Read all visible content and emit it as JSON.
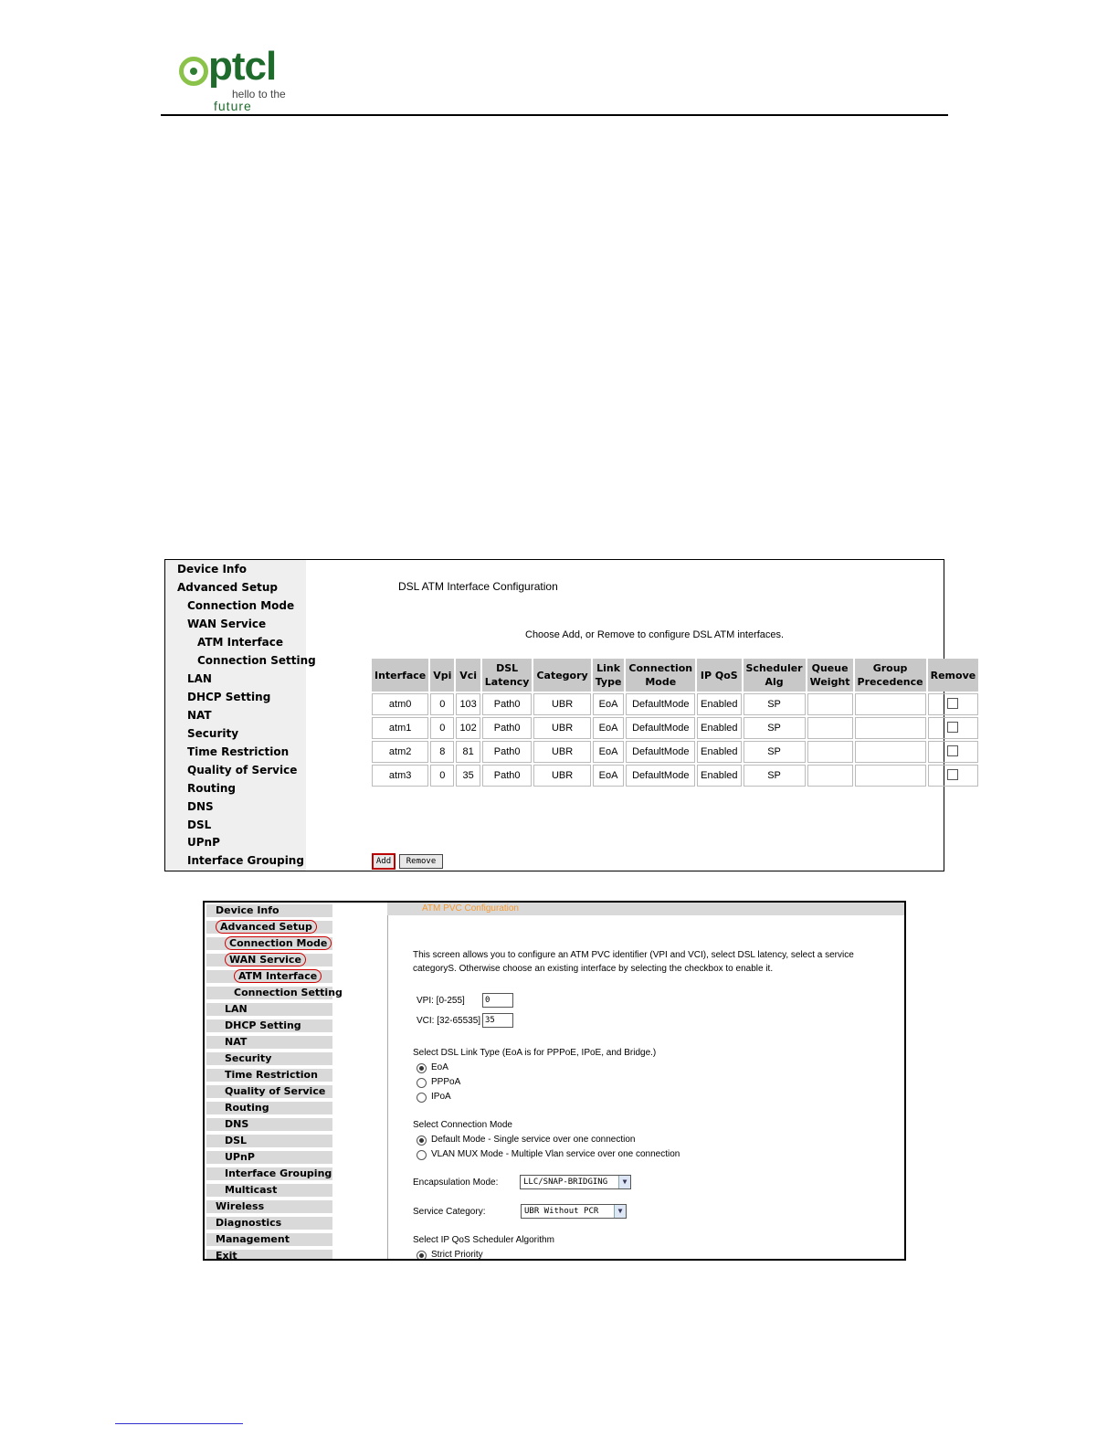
{
  "header": {
    "logo_word": "ptcl",
    "logo_tag1": "hello to the",
    "logo_tag2": "future"
  },
  "shot1": {
    "nav": [
      "Device Info",
      "Advanced Setup",
      "Connection Mode",
      "WAN Service",
      "ATM Interface",
      "Connection Setting",
      "LAN",
      "DHCP Setting",
      "NAT",
      "Security",
      "Time Restriction",
      "Quality of Service",
      "Routing",
      "DNS",
      "DSL",
      "UPnP",
      "Interface Grouping"
    ],
    "title": "DSL ATM Interface Configuration",
    "instruction": "Choose Add, or Remove to configure DSL ATM interfaces.",
    "columns": [
      "Interface",
      "Vpi",
      "Vci",
      "DSL Latency",
      "Category",
      "Link Type",
      "Connection Mode",
      "IP QoS",
      "Scheduler Alg",
      "Queue Weight",
      "Group Precedence",
      "Remove"
    ],
    "rows": [
      [
        "atm0",
        "0",
        "103",
        "Path0",
        "UBR",
        "EoA",
        "DefaultMode",
        "Enabled",
        "SP",
        "",
        ""
      ],
      [
        "atm1",
        "0",
        "102",
        "Path0",
        "UBR",
        "EoA",
        "DefaultMode",
        "Enabled",
        "SP",
        "",
        ""
      ],
      [
        "atm2",
        "8",
        "81",
        "Path0",
        "UBR",
        "EoA",
        "DefaultMode",
        "Enabled",
        "SP",
        "",
        ""
      ],
      [
        "atm3",
        "0",
        "35",
        "Path0",
        "UBR",
        "EoA",
        "DefaultMode",
        "Enabled",
        "SP",
        "",
        ""
      ]
    ],
    "add_label": "Add",
    "remove_label": "Remove"
  },
  "shot2": {
    "nav": [
      "Device Info",
      "Advanced Setup",
      "Connection Mode",
      "WAN Service",
      "ATM Interface",
      "Connection Setting",
      "LAN",
      "DHCP Setting",
      "NAT",
      "Security",
      "Time Restriction",
      "Quality of Service",
      "Routing",
      "DNS",
      "DSL",
      "UPnP",
      "Interface Grouping",
      "Multicast",
      "Wireless",
      "Diagnostics",
      "Management",
      "Exit"
    ],
    "title": "ATM PVC Configuration",
    "intro_line1": "This screen allows you to configure an ATM PVC identifier (VPI and VCI), select DSL latency, select a service",
    "intro_line2": "categoryS. Otherwise choose an existing interface by selecting the checkbox to enable it.",
    "vpi_label": "VPI: [0-255]",
    "vpi_value": "0",
    "vci_label": "VCI: [32-65535]",
    "vci_value": "35",
    "link_type_heading": "Select DSL Link Type (EoA is for PPPoE, IPoE, and Bridge.)",
    "link_types": [
      "EoA",
      "PPPoA",
      "IPoA"
    ],
    "conn_mode_heading": "Select Connection Mode",
    "conn_modes": [
      "Default Mode - Single service over one connection",
      "VLAN MUX Mode - Multiple Vlan service over one connection"
    ],
    "encap_label": "Encapsulation Mode:",
    "encap_value": "LLC/SNAP-BRIDGING",
    "service_label": "Service Category:",
    "service_value": "UBR Without PCR",
    "qos_heading": "Select IP QoS Scheduler Algorithm",
    "qos_option": "Strict Priority"
  }
}
